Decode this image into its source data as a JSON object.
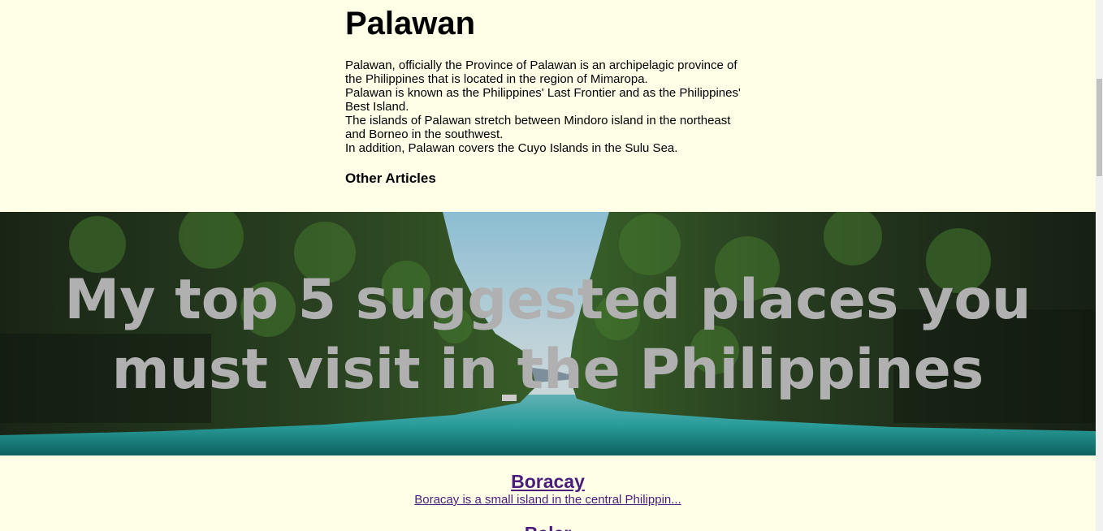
{
  "article": {
    "title": "Palawan",
    "paragraphs": [
      "Palawan, officially the Province of Palawan is an archipelagic province of the Philippines that is located in the region of Mimaropa.",
      "Palawan is known as the Philippines' Last Frontier and as the Philippines' Best Island.",
      "The islands of Palawan stretch between Mindoro island in the northeast and Borneo in the southwest.",
      "In addition, Palawan covers the Cuyo Islands in the Sulu Sea."
    ],
    "other_heading": "Other Articles"
  },
  "hero": {
    "title": "My top 5 suggested places you must visit in the Philippines"
  },
  "places": [
    {
      "name": "Boracay",
      "desc": "Boracay is a small island in the central Philippin..."
    },
    {
      "name": "Baler",
      "desc": ""
    }
  ],
  "colors": {
    "background": "#ffffe8",
    "link": "#4b1d7a",
    "hero_title": "#b0b0b0"
  }
}
